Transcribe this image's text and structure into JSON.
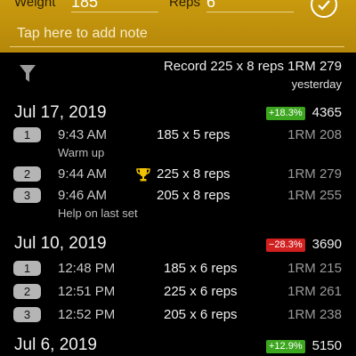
{
  "header": {
    "weight_label": "Weight",
    "weight_value": "185",
    "reps_label": "Reps",
    "reps_value": "6",
    "note_placeholder": "Tap here to add note",
    "confirm_icon": "check-circle-icon"
  },
  "summary": {
    "filter_icon": "filter-icon",
    "record_text": "Record 225 x 8 reps 1RM 279",
    "record_time": "yesterday"
  },
  "sessions": [
    {
      "date": "Jul 17, 2019",
      "change": "+18.3%",
      "trend": "up",
      "total": "4365",
      "sets": [
        {
          "num": "1",
          "time": "9:43 AM",
          "work": "185 x 5 reps",
          "orm": "1RM 208",
          "note": "Warm up",
          "record": false
        },
        {
          "num": "2",
          "time": "9:44 AM",
          "work": "225 x 8 reps",
          "orm": "1RM 279",
          "note": "",
          "record": true
        },
        {
          "num": "3",
          "time": "9:46 AM",
          "work": "205 x 8 reps",
          "orm": "1RM 255",
          "note": "Help on last set",
          "record": false
        }
      ]
    },
    {
      "date": "Jul 10, 2019",
      "change": "−28.3%",
      "trend": "down",
      "total": "3690",
      "sets": [
        {
          "num": "1",
          "time": "12:48 PM",
          "work": "185 x 6 reps",
          "orm": "1RM 215",
          "note": "",
          "record": false
        },
        {
          "num": "2",
          "time": "12:51 PM",
          "work": "225 x 6 reps",
          "orm": "1RM 261",
          "note": "",
          "record": false
        },
        {
          "num": "3",
          "time": "12:52 PM",
          "work": "205 x 6 reps",
          "orm": "1RM 238",
          "note": "",
          "record": false
        }
      ]
    },
    {
      "date": "Jul 6, 2019",
      "change": "+12.9%",
      "trend": "up",
      "total": "5150",
      "sets": []
    }
  ],
  "colors": {
    "accent": "#c99a0e",
    "up": "#3da61f",
    "down": "#d21f1f"
  }
}
